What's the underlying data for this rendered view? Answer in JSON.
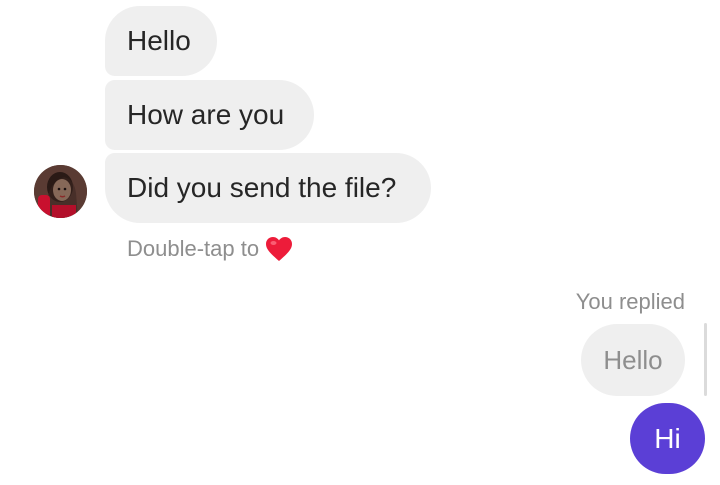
{
  "conversation": {
    "incoming_messages": [
      {
        "text": "Hello"
      },
      {
        "text": "How are you"
      },
      {
        "text": "Did you send the file?"
      }
    ],
    "double_tap_hint": "Double-tap to",
    "reply": {
      "meta_label": "You replied",
      "quoted_text": "Hello",
      "message_text": "Hi"
    }
  },
  "colors": {
    "incoming_bubble": "#efefef",
    "outgoing_bubble": "#5b3fd6",
    "secondary_text": "#8e8e8e",
    "heart": "#ed1c3a"
  },
  "icons": {
    "heart": "heart-icon",
    "avatar": "sender-avatar"
  }
}
